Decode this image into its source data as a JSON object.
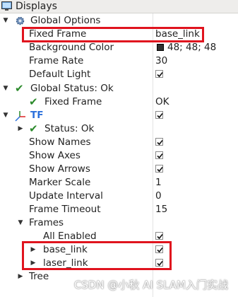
{
  "panel": {
    "title": "Displays",
    "icon": "monitor-icon"
  },
  "global_options": {
    "label": "Global Options",
    "icon": "gear-icon",
    "fixed_frame_label": "Fixed Frame",
    "fixed_frame_value": "base_link",
    "background_color_label": "Background Color",
    "background_color_value": "48; 48; 48",
    "background_color_hex": "#303030",
    "frame_rate_label": "Frame Rate",
    "frame_rate_value": "30",
    "default_light_label": "Default Light",
    "default_light_checked": true
  },
  "global_status": {
    "label": "Global Status: Ok",
    "fixed_frame_label": "Fixed Frame",
    "fixed_frame_value": "OK"
  },
  "tf": {
    "label": "TF",
    "icon": "tf-axes-icon",
    "enabled": true,
    "status_label": "Status: Ok",
    "show_names_label": "Show Names",
    "show_names_checked": true,
    "show_axes_label": "Show Axes",
    "show_axes_checked": true,
    "show_arrows_label": "Show Arrows",
    "show_arrows_checked": true,
    "marker_scale_label": "Marker Scale",
    "marker_scale_value": "1",
    "update_interval_label": "Update Interval",
    "update_interval_value": "0",
    "frame_timeout_label": "Frame Timeout",
    "frame_timeout_value": "15",
    "frames_label": "Frames",
    "all_enabled_label": "All Enabled",
    "all_enabled_checked": true,
    "frames": [
      {
        "label": "base_link",
        "checked": true
      },
      {
        "label": "laser_link",
        "checked": true
      }
    ],
    "tree_label": "Tree"
  },
  "watermark": "CSDN @小秋 AI SLAM入门实战",
  "colors": {
    "highlight": "#e0141e",
    "ok_check": "#2b8a2b",
    "tf_blue": "#2a6fdb"
  }
}
